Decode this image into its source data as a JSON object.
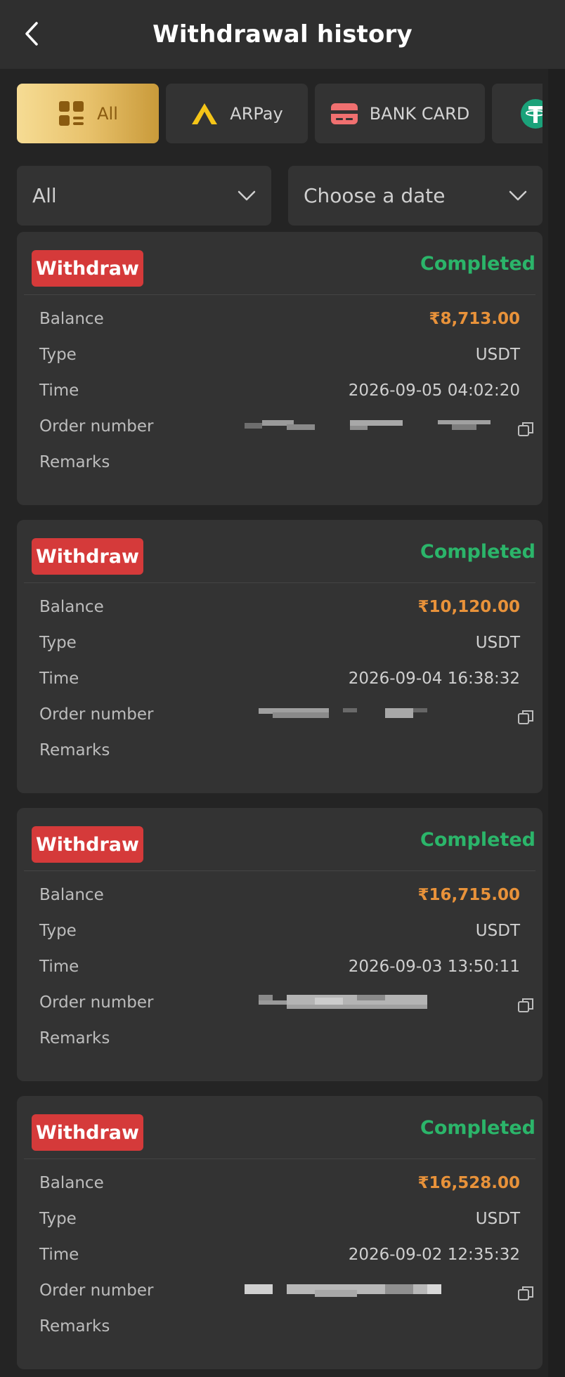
{
  "header": {
    "title": "Withdrawal history"
  },
  "tabs": [
    {
      "label": "All",
      "icon": "grid-list-icon",
      "active": true
    },
    {
      "label": "ARPay",
      "icon": "arpay-logo-icon"
    },
    {
      "label": "BANK CARD",
      "icon": "bank-card-icon"
    },
    {
      "label": "",
      "icon": "usdt-tether-icon"
    }
  ],
  "filters": {
    "type": "All",
    "date": "Choose a date"
  },
  "labels": {
    "badge": "Withdraw",
    "balance": "Balance",
    "type": "Type",
    "time": "Time",
    "order": "Order number",
    "remarks": "Remarks"
  },
  "records": [
    {
      "badge": "Withdraw",
      "status": "Completed",
      "balance": "₹8,713.00",
      "type": "USDT",
      "time": "2026-09-05 04:02:20",
      "remarks": ""
    },
    {
      "badge": "Withdraw",
      "status": "Completed",
      "balance": "₹10,120.00",
      "type": "USDT",
      "time": "2026-09-04 16:38:32",
      "remarks": ""
    },
    {
      "badge": "Withdraw",
      "status": "Completed",
      "balance": "₹16,715.00",
      "type": "USDT",
      "time": "2026-09-03 13:50:11",
      "remarks": ""
    },
    {
      "badge": "Withdraw",
      "status": "Completed",
      "balance": "₹16,528.00",
      "type": "USDT",
      "time": "2026-09-02 12:35:32",
      "remarks": ""
    }
  ],
  "colors": {
    "status_completed": "#2bb56a",
    "badge_withdraw": "#d53a3a",
    "amount": "#e8923a",
    "tab_active_gold": "#e8c26c"
  }
}
